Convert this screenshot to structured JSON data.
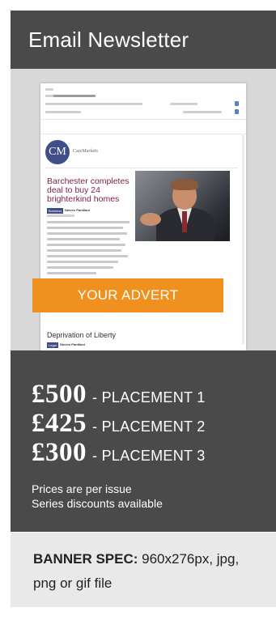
{
  "header": {
    "title": "Email Newsletter"
  },
  "preview": {
    "logo_initials": "CM",
    "logo_text": "CareMarkets",
    "headline": "Barchester completes deal to buy 24 brighterkind homes",
    "tag": "Business",
    "byline": "Steven Pantilani",
    "advert_label": "YOUR ADVERT",
    "sub_headline": "Deprivation of Liberty",
    "sub_tag": "Legal",
    "sub_byline": "Steven Pantilani"
  },
  "pricing": {
    "rows": [
      {
        "amount": "£500",
        "label": "- PLACEMENT 1"
      },
      {
        "amount": "£425",
        "label": "- PLACEMENT 2"
      },
      {
        "amount": "£300",
        "label": "- PLACEMENT 3"
      }
    ],
    "note_1": "Prices are per issue",
    "note_2": "Series discounts available"
  },
  "spec": {
    "label": "BANNER SPEC:",
    "value": "960x276px, jpg, png or gif file"
  },
  "colors": {
    "dark_panel": "#4a4a4a",
    "advert_orange": "#f0901e",
    "light_panel": "#e9e9e9",
    "preview_bg": "#d8d8d8"
  }
}
